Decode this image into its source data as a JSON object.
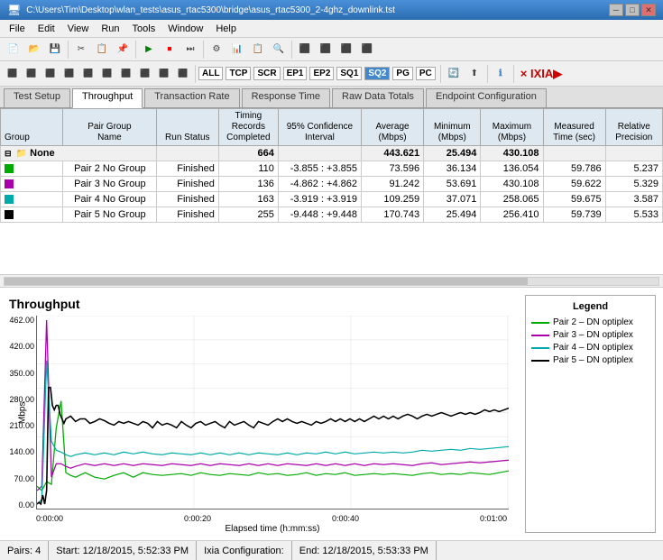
{
  "titlebar": {
    "title": "C:\\Users\\Tim\\Desktop\\wlan_tests\\asus_rtac5300\\bridge\\asus_rtac5300_2-4ghz_downlink.tst",
    "minimize": "─",
    "maximize": "□",
    "close": "✕"
  },
  "menubar": {
    "items": [
      "File",
      "Edit",
      "View",
      "Run",
      "Tools",
      "Window",
      "Help"
    ]
  },
  "toolbar2": {
    "labels": [
      "ALL",
      "TCP",
      "SCR",
      "EP1",
      "EP2",
      "SQ1",
      "SQ2",
      "PG",
      "PC"
    ],
    "active": "SQ2",
    "info_icon": "ℹ",
    "brand": "× IXIA"
  },
  "tabs": {
    "items": [
      "Test Setup",
      "Throughput",
      "Transaction Rate",
      "Response Time",
      "Raw Data Totals",
      "Endpoint Configuration"
    ],
    "active": "Throughput"
  },
  "table": {
    "headers": {
      "group": "Group",
      "pair_group_name": "Pair Group Name",
      "run_status": "Run Status",
      "timing_records": "Timing Records Completed",
      "confidence_interval": "95% Confidence Interval",
      "average_mbps": "Average (Mbps)",
      "minimum_mbps": "Minimum (Mbps)",
      "maximum_mbps": "Maximum (Mbps)",
      "measured_time": "Measured Time (sec)",
      "relative_precision": "Relative Precision"
    },
    "summary_row": {
      "label": "None",
      "records": "664",
      "average": "443.621",
      "minimum": "25.494",
      "maximum": "430.108"
    },
    "rows": [
      {
        "color": "#00aa00",
        "label": "Pair 2 No Group",
        "status": "Finished",
        "records": "110",
        "confidence": "-3.855 : +3.855",
        "average": "73.596",
        "minimum": "36.134",
        "maximum": "136.054",
        "time": "59.786",
        "precision": "5.237"
      },
      {
        "color": "#aa00aa",
        "label": "Pair 3 No Group",
        "status": "Finished",
        "records": "136",
        "confidence": "-4.862 : +4.862",
        "average": "91.242",
        "minimum": "53.691",
        "maximum": "430.108",
        "time": "59.622",
        "precision": "5.329"
      },
      {
        "color": "#00aaaa",
        "label": "Pair 4 No Group",
        "status": "Finished",
        "records": "163",
        "confidence": "-3.919 : +3.919",
        "average": "109.259",
        "minimum": "37.071",
        "maximum": "258.065",
        "time": "59.675",
        "precision": "3.587"
      },
      {
        "color": "#000000",
        "label": "Pair 5 No Group",
        "status": "Finished",
        "records": "255",
        "confidence": "-9.448 : +9.448",
        "average": "170.743",
        "minimum": "25.494",
        "maximum": "256.410",
        "time": "59.739",
        "precision": "5.533"
      }
    ]
  },
  "chart": {
    "title": "Throughput",
    "x_label": "Elapsed time (h:mm:ss)",
    "y_label": "Mbps",
    "y_values": [
      "462.00",
      "420.00",
      "350.00",
      "280.00",
      "210.00",
      "140.00",
      "70.00",
      "0.00"
    ],
    "x_values": [
      "0:00:00",
      "0:00:20",
      "0:00:40",
      "0:01:00"
    ]
  },
  "legend": {
    "title": "Legend",
    "items": [
      {
        "color": "#00aa00",
        "label": "Pair 2 – DN optiplex"
      },
      {
        "color": "#aa00aa",
        "label": "Pair 3 – DN optiplex"
      },
      {
        "color": "#00aaaa",
        "label": "Pair 4 – DN optiplex"
      },
      {
        "color": "#000000",
        "label": "Pair 5 – DN optiplex"
      }
    ]
  },
  "statusbar": {
    "pairs": "Pairs: 4",
    "start": "Start: 12/18/2015, 5:52:33 PM",
    "ixia_config": "Ixia Configuration:",
    "end": "End: 12/18/2015, 5:53:33 PM"
  }
}
